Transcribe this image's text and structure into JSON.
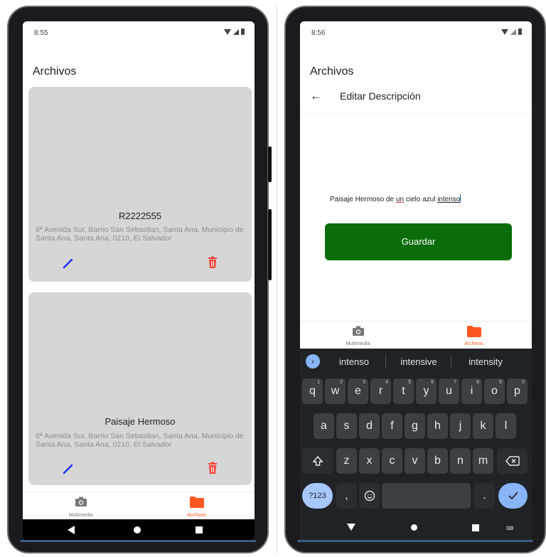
{
  "left_screen": {
    "status_time": "8:55",
    "title": "Archivos",
    "cards": [
      {
        "title": "R2222555",
        "address": "6ª Avenida Sur, Barrio San Sebastian, Santa Ana, Municipio de Santa Ana, Santa Ana, 0210, El Salvador"
      },
      {
        "title": "Paisaje Hermoso",
        "address": "6ª Avenida Sur, Barrio San Sebastian, Santa Ana, Municipio de Santa Ana, Santa Ana, 0210, El Salvador"
      }
    ],
    "nav": [
      {
        "label": "Multimedia",
        "icon": "camera-icon"
      },
      {
        "label": "Archivos",
        "icon": "folder-icon"
      }
    ]
  },
  "right_screen": {
    "status_time": "8:56",
    "title": "Archivos",
    "appbar_title": "Editar Descripción",
    "description": {
      "before": "Paisaje Hermoso de ",
      "typo": "un",
      "middle": " cielo azul ",
      "current": "intenso"
    },
    "save_label": "Guardar",
    "nav": [
      {
        "label": "Multimedia",
        "icon": "camera-icon"
      },
      {
        "label": "Archivos",
        "icon": "folder-icon"
      }
    ],
    "keyboard": {
      "suggestions": [
        "intenso",
        "intensive",
        "intensity"
      ],
      "row1": [
        "q",
        "w",
        "e",
        "r",
        "t",
        "y",
        "u",
        "i",
        "o",
        "p"
      ],
      "row1_hints": [
        "1",
        "2",
        "3",
        "4",
        "5",
        "6",
        "7",
        "8",
        "9",
        "0"
      ],
      "row2": [
        "a",
        "s",
        "d",
        "f",
        "g",
        "h",
        "j",
        "k",
        "l"
      ],
      "row3": [
        "z",
        "x",
        "c",
        "v",
        "b",
        "n",
        "m"
      ],
      "symbols_label": "?123",
      "comma": ",",
      "period": "."
    }
  },
  "colors": {
    "accent": "#ff5722",
    "save_button": "#0a6d0a",
    "card_bg": "#d6d6d6",
    "edit_icon": "#1a2ee8",
    "trash_icon": "#f44336"
  }
}
